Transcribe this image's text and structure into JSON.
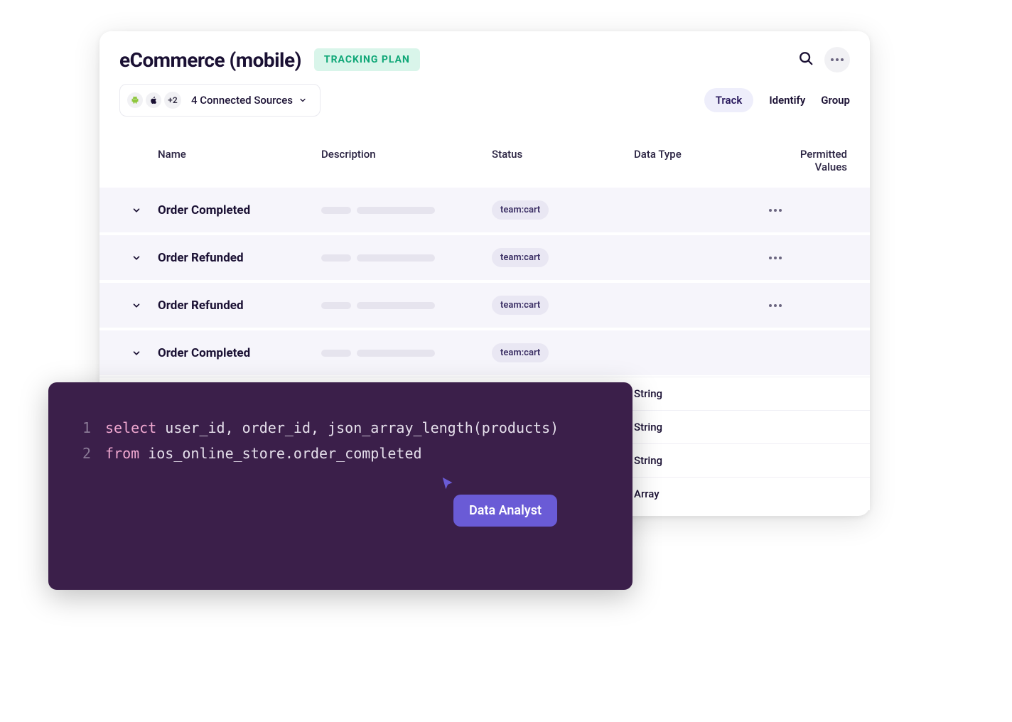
{
  "header": {
    "title": "eCommerce (mobile)",
    "badge": "TRACKING PLAN"
  },
  "sources": {
    "extra_count": "+2",
    "label": "4 Connected Sources"
  },
  "tabs": {
    "track": "Track",
    "identify": "Identify",
    "group": "Group"
  },
  "columns": {
    "name": "Name",
    "description": "Description",
    "status": "Status",
    "data_type": "Data Type",
    "permitted": "Permitted Values"
  },
  "rows": [
    {
      "name": "Order Completed",
      "status": "team:cart"
    },
    {
      "name": "Order Refunded",
      "status": "team:cart"
    },
    {
      "name": "Order Refunded",
      "status": "team:cart"
    },
    {
      "name": "Order Completed",
      "status": "team:cart"
    }
  ],
  "sub_rows": [
    {
      "data_type": "String"
    },
    {
      "data_type": "String"
    },
    {
      "data_type": "String"
    },
    {
      "data_type": "Array"
    }
  ],
  "sql": {
    "line1_kw": "select",
    "line1_rest": " user_id, order_id, json_array_length(products)",
    "line2_kw": "from",
    "line2_rest": " ios_online_store.order_completed"
  },
  "analyst_label": "Data Analyst",
  "line_numbers": {
    "l1": "1",
    "l2": "2"
  }
}
